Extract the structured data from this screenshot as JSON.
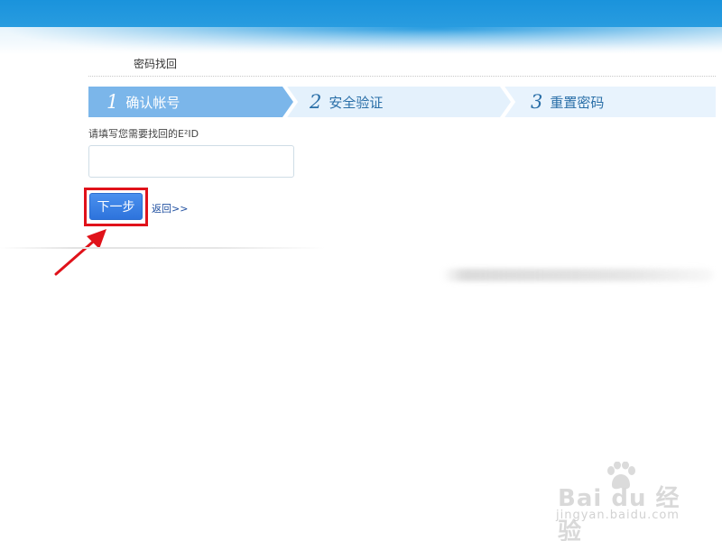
{
  "page": {
    "title": "密码找回"
  },
  "steps": [
    {
      "number": "1",
      "label": "确认帐号",
      "state": "active"
    },
    {
      "number": "2",
      "label": "安全验证",
      "state": "inactive"
    },
    {
      "number": "3",
      "label": "重置密码",
      "state": "inactive"
    }
  ],
  "form": {
    "prompt": "请填写您需要找回的E²ID",
    "eid_value": "",
    "eid_placeholder": "",
    "next_button": "下一步",
    "back_link": "返回>>"
  },
  "colors": {
    "header_blue": "#1a93dc",
    "step_active": "#7bb6ea",
    "step_inactive": "#e4f1fc",
    "button_blue": "#2e73dc",
    "highlight_red": "#e0121a"
  },
  "watermark": {
    "brand": "Bai du 经验",
    "url": "jingyan.baidu.com"
  }
}
